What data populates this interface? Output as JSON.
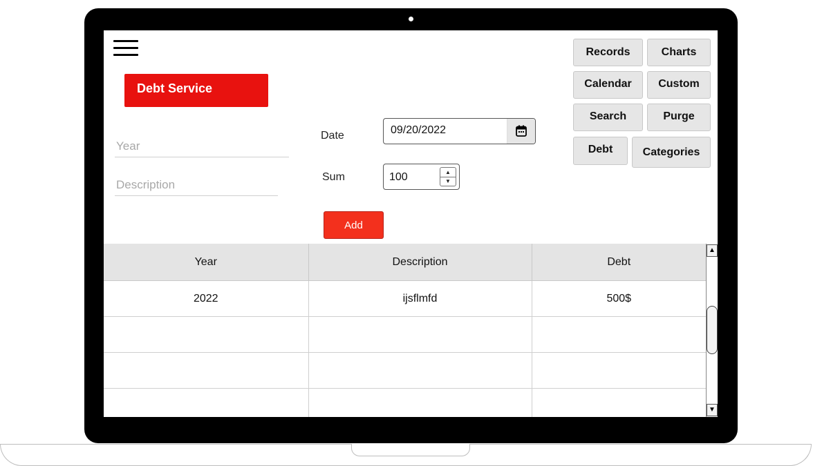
{
  "app": {
    "title": "Debt Service"
  },
  "form": {
    "year_placeholder": "Year",
    "description_placeholder": "Description",
    "date_label": "Date",
    "date_value": "09/20/2022",
    "sum_label": "Sum",
    "sum_value": "100",
    "add_label": "Add"
  },
  "nav": {
    "records": "Records",
    "charts": "Charts",
    "calendar": "Calendar",
    "custom": "Custom",
    "search": "Search",
    "purge": "Purge",
    "debt": "Debt",
    "categories": "Categories"
  },
  "table": {
    "headers": [
      "Year",
      "Description",
      "Debt"
    ],
    "rows": [
      [
        "2022",
        "ijsflmfd",
        "500$"
      ],
      [
        "",
        "",
        ""
      ],
      [
        "",
        "",
        ""
      ],
      [
        "",
        "",
        ""
      ]
    ]
  },
  "colors": {
    "title_bar": "#e8120f",
    "add_button": "#f3301d",
    "nav_button": "#e6e6e6",
    "table_header": "#e4e4e4"
  },
  "icons": {
    "menu": "hamburger-menu-icon",
    "date_picker": "calendar-icon",
    "stepper_up": "caret-up-icon",
    "stepper_down": "caret-down-icon"
  }
}
